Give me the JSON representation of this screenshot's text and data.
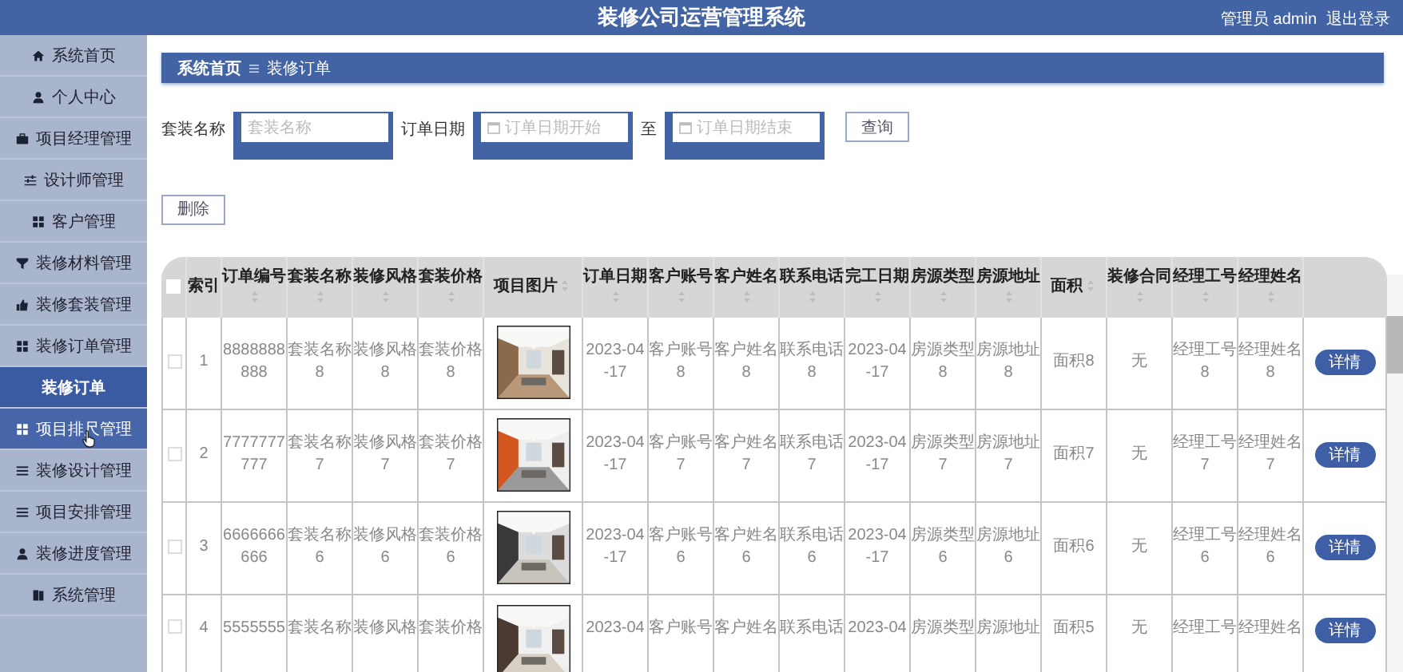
{
  "header": {
    "title": "装修公司运营管理系统",
    "user": "管理员 admin",
    "logout": "退出登录"
  },
  "sidebar": {
    "items": [
      {
        "kind": "menu",
        "label": "系统首页",
        "selected": false,
        "hovered": false
      },
      {
        "kind": "menu",
        "label": "个人中心",
        "selected": false,
        "hovered": false
      },
      {
        "kind": "menu",
        "label": "项目经理管理",
        "selected": false,
        "hovered": false
      },
      {
        "kind": "menu",
        "label": "设计师管理",
        "selected": false,
        "hovered": false
      },
      {
        "kind": "menu",
        "label": "客户管理",
        "selected": false,
        "hovered": false
      },
      {
        "kind": "menu",
        "label": "装修材料管理",
        "selected": false,
        "hovered": false
      },
      {
        "kind": "menu",
        "label": "装修套装管理",
        "selected": false,
        "hovered": false
      },
      {
        "kind": "menu",
        "label": "装修订单管理",
        "selected": false,
        "hovered": false
      },
      {
        "kind": "submenu",
        "label": "装修订单",
        "selected": true,
        "hovered": false
      },
      {
        "kind": "menu",
        "label": "项目排尺管理",
        "selected": false,
        "hovered": true
      },
      {
        "kind": "menu",
        "label": "装修设计管理",
        "selected": false,
        "hovered": false
      },
      {
        "kind": "menu",
        "label": "项目安排管理",
        "selected": false,
        "hovered": false
      },
      {
        "kind": "menu",
        "label": "装修进度管理",
        "selected": false,
        "hovered": false
      },
      {
        "kind": "menu",
        "label": "系统管理",
        "selected": false,
        "hovered": false
      }
    ]
  },
  "breadcrumb": [
    "系统首页",
    "装修订单"
  ],
  "search": {
    "name_label": "套装名称",
    "name_placeholder": "套装名称",
    "date_label": "订单日期",
    "start_placeholder": "订单日期开始",
    "to": "至",
    "end_placeholder": "订单日期结束",
    "button": "查询"
  },
  "delete_button": "删除",
  "table": {
    "select_all": false,
    "columns": [
      {
        "label": "索引",
        "sortable": false,
        "kind": "text"
      },
      {
        "label": "订单编号",
        "sortable": true,
        "kind": "text"
      },
      {
        "label": "套装名称",
        "sortable": true,
        "kind": "text"
      },
      {
        "label": "装修风格",
        "sortable": true,
        "kind": "text"
      },
      {
        "label": "套装价格",
        "sortable": true,
        "kind": "text"
      },
      {
        "label": "项目图片",
        "sortable": true,
        "kind": "picture"
      },
      {
        "label": "订单日期",
        "sortable": true,
        "kind": "text"
      },
      {
        "label": "客户账号",
        "sortable": true,
        "kind": "text"
      },
      {
        "label": "客户姓名",
        "sortable": true,
        "kind": "text"
      },
      {
        "label": "联系电话",
        "sortable": true,
        "kind": "text"
      },
      {
        "label": "完工日期",
        "sortable": true,
        "kind": "text"
      },
      {
        "label": "房源类型",
        "sortable": true,
        "kind": "text"
      },
      {
        "label": "房源地址",
        "sortable": true,
        "kind": "text"
      },
      {
        "label": "面积",
        "sortable": true,
        "kind": "text"
      },
      {
        "label": "装修合同",
        "sortable": true,
        "kind": "text"
      },
      {
        "label": "经理工号",
        "sortable": true,
        "kind": "text"
      },
      {
        "label": "经理姓名",
        "sortable": true,
        "kind": "text"
      }
    ],
    "rows": [
      {
        "checked": false,
        "cells": [
          "1",
          "8888888888",
          "套装名称8",
          "装修风格8",
          "套装价格8",
          {
            "kind": "picture"
          },
          "2023-04-17",
          "客户账号8",
          "客户姓名8",
          "联系电话8",
          "2023-04-17",
          "房源类型8",
          "房源地址8",
          "面积8",
          "无",
          "经理工号8",
          "经理姓名8"
        ],
        "action": "详情"
      },
      {
        "checked": false,
        "cells": [
          "2",
          "7777777777",
          "套装名称7",
          "装修风格7",
          "套装价格7",
          {
            "kind": "picture"
          },
          "2023-04-17",
          "客户账号7",
          "客户姓名7",
          "联系电话7",
          "2023-04-17",
          "房源类型7",
          "房源地址7",
          "面积7",
          "无",
          "经理工号7",
          "经理姓名7"
        ],
        "action": "详情"
      },
      {
        "checked": false,
        "cells": [
          "3",
          "6666666666",
          "套装名称6",
          "装修风格6",
          "套装价格6",
          {
            "kind": "picture"
          },
          "2023-04-17",
          "客户账号6",
          "客户姓名6",
          "联系电话6",
          "2023-04-17",
          "房源类型6",
          "房源地址6",
          "面积6",
          "无",
          "经理工号6",
          "经理姓名6"
        ],
        "action": "详情"
      },
      {
        "checked": false,
        "cells": [
          "4",
          "5555555",
          "套装名称",
          "装修风格",
          "套装价格",
          {
            "kind": "picture"
          },
          "2023-04",
          "客户账号",
          "客户姓名",
          "联系电话",
          "2023-04",
          "房源类型",
          "房源地址",
          "面积5",
          "无",
          "经理工号",
          "经理姓名"
        ],
        "action": "详情"
      }
    ]
  }
}
